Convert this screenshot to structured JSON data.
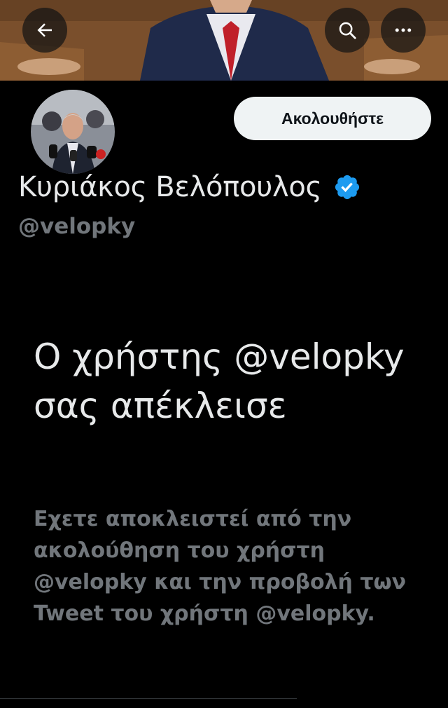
{
  "header": {
    "back_icon": "arrow-left-icon",
    "search_icon": "search-icon",
    "more_icon": "more-horizontal-icon"
  },
  "profile": {
    "follow_label": "Ακολουθήστε",
    "display_name": "Κυριάκος Βελόπουλος",
    "handle": "@velopky",
    "verified": true
  },
  "blocked": {
    "title": "Ο χρήστης @velopky σας απέκλεισε",
    "description": "Εχετε αποκλειστεί από την ακολούθηση του χρήστη @velopky και την προβολή των Tweet του χρήστη @velopky."
  },
  "colors": {
    "background": "#000000",
    "verified_blue": "#1d9bf0",
    "secondary_text": "#71767b",
    "follow_button_bg": "#eff3f4"
  }
}
